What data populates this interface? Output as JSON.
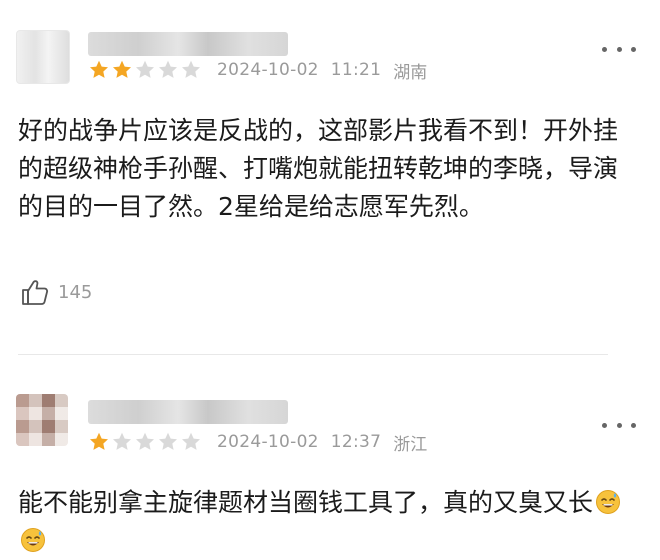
{
  "reviews": [
    {
      "rating": 2,
      "rating_max": 5,
      "date": "2024-10-02",
      "time": "11:21",
      "location": "湖南",
      "content": "好的战争片应该是反战的，这部影片我看不到！开外挂的超级神枪手孙醒、打嘴炮就能扭转乾坤的李晓，导演的目的一目了然。2星给是给志愿军先烈。",
      "likes": "145"
    },
    {
      "rating": 1,
      "rating_max": 5,
      "date": "2024-10-02",
      "time": "12:37",
      "location": "浙江",
      "content": "能不能别拿主旋律题材当圈钱工具了，真的又臭又长"
    }
  ],
  "colors": {
    "star_active": "#f4a623",
    "star_inactive": "#d9d9d9",
    "meta_text": "#9a9a9a"
  },
  "icons": [
    "more-options-icon",
    "thumbs-up-icon",
    "star-icon",
    "sweat-smile-emoji-icon"
  ]
}
